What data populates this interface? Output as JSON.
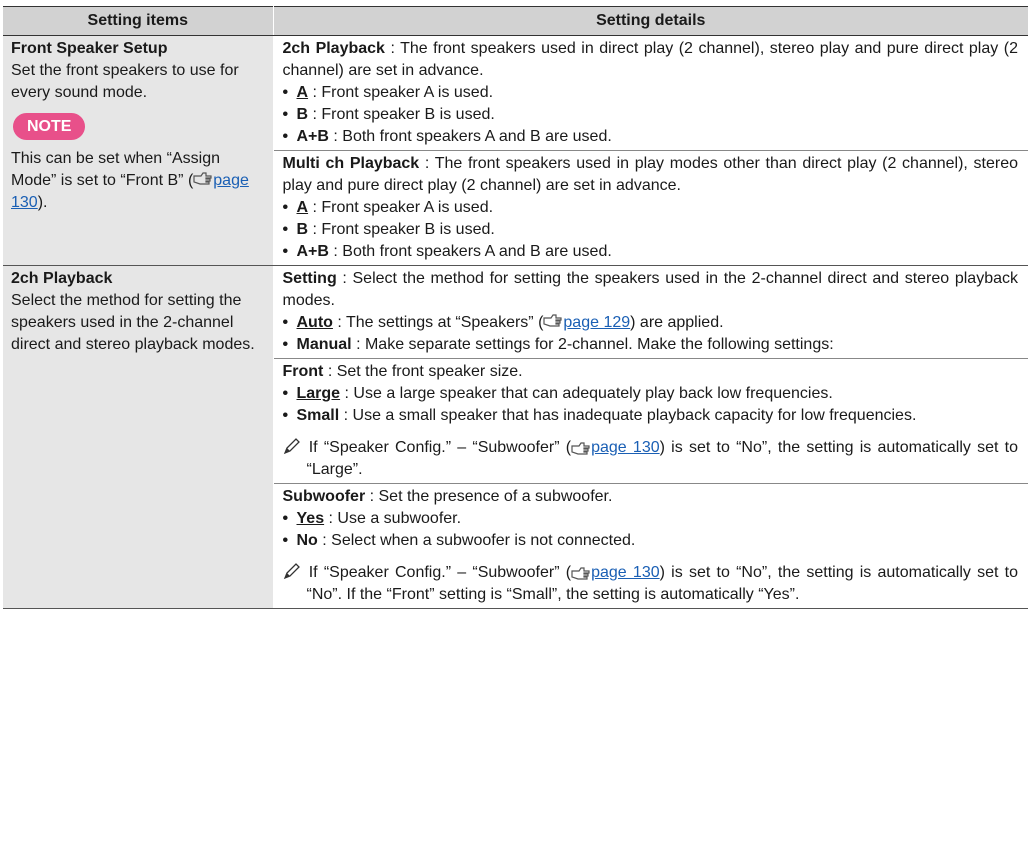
{
  "table": {
    "headers": [
      "Setting items",
      "Setting details"
    ],
    "page_ref_icon": "reference-hand-icon",
    "note_icon": "pencil-note-icon",
    "accent": "#e8508a",
    "link_color": "#1a5fb4",
    "row1": {
      "title": "Front Speaker Setup",
      "desc": "Set the front speakers to use for every sound mode.",
      "note_label": "NOTE",
      "note_text_pre": "This can be set when “Assign Mode” is set to “Front B” (",
      "note_link": "page 130",
      "note_text_post": ").",
      "b1": {
        "label": "2ch Playback",
        "text": " : The front speakers used in direct play (2 channel), stereo play and pure direct play (2 channel) are set in advance.",
        "options": [
          {
            "key": "A",
            "text": " : Front speaker A is used."
          },
          {
            "key": "B",
            "text": " : Front speaker B is used."
          },
          {
            "key": "A+B",
            "text": " : Both front speakers A and B are used."
          }
        ]
      },
      "b2": {
        "label": "Multi ch Playback",
        "text": " : The front speakers used in play modes other than direct play (2 channel), stereo play and pure direct play (2 channel) are set in advance.",
        "options": [
          {
            "key": "A",
            "text": " : Front speaker A is used."
          },
          {
            "key": "B",
            "text": " : Front speaker B is used."
          },
          {
            "key": "A+B",
            "text": " : Both front speakers A and B are used."
          }
        ]
      }
    },
    "row2": {
      "title": "2ch Playback",
      "desc": "Select the method for setting the speakers used in the 2-channel direct and stereo playback modes.",
      "b1": {
        "label": "Setting",
        "text": " : Select the method for setting the speakers used in the 2-channel direct and stereo playback modes.",
        "opt1_key": "Auto",
        "opt1_pre": " : The settings at “Speakers” (",
        "opt1_link": "page 129",
        "opt1_post": ") are applied.",
        "opt2_key": "Manual",
        "opt2_text": " : Make separate settings for 2-channel. Make the following settings:"
      },
      "b2": {
        "label": "Front",
        "text": " : Set the front speaker size.",
        "opt1_key": "Large",
        "opt1_text": " : Use a large speaker that can adequately play back low frequencies.",
        "opt2_key": "Small",
        "opt2_text": " : Use a small speaker that has inadequate playback capacity for low frequencies.",
        "note_pre": "If “Speaker Config.” – “Subwoofer” (",
        "note_link": "page 130",
        "note_post": ") is set to “No”, the setting is automatically set to “Large”."
      },
      "b3": {
        "label": "Subwoofer",
        "text": " : Set the presence of a subwoofer.",
        "opt1_key": "Yes",
        "opt1_text": " : Use a subwoofer.",
        "opt2_key": "No",
        "opt2_text": " : Select when a subwoofer is not connected.",
        "note_pre": "If “Speaker Config.” – “Subwoofer” (",
        "note_link": "page 130",
        "note_post": ") is set to “No”, the setting is automatically set to “No”. If the “Front” setting is “Small”, the setting is automatically “Yes”."
      }
    }
  }
}
